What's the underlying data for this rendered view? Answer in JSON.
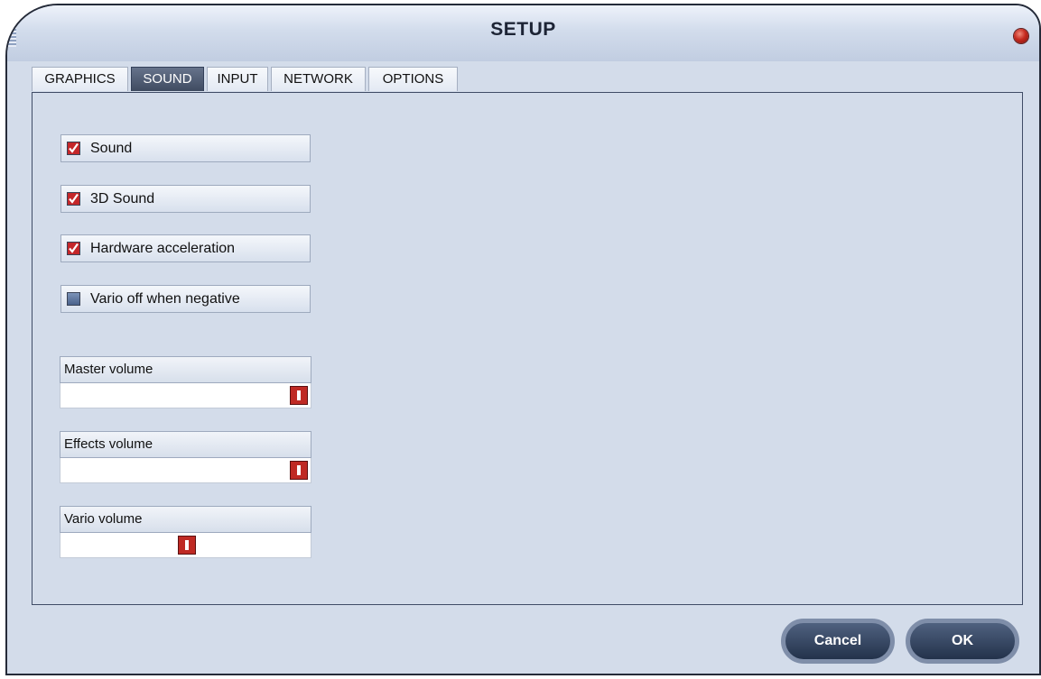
{
  "window": {
    "title": "SETUP"
  },
  "tabs": [
    {
      "label": "GRAPHICS",
      "active": false
    },
    {
      "label": "SOUND",
      "active": true
    },
    {
      "label": "INPUT",
      "active": false
    },
    {
      "label": "NETWORK",
      "active": false
    },
    {
      "label": "OPTIONS",
      "active": false
    }
  ],
  "checkboxes": [
    {
      "label": "Sound",
      "checked": true
    },
    {
      "label": "3D Sound",
      "checked": true
    },
    {
      "label": "Hardware acceleration",
      "checked": true
    },
    {
      "label": "Vario off when negative",
      "checked": false
    }
  ],
  "volumes": [
    {
      "label": "Master volume",
      "level": 1.0
    },
    {
      "label": "Effects volume",
      "level": 1.0
    },
    {
      "label": "Vario volume",
      "level": 0.5
    }
  ],
  "buttons": {
    "cancel": "Cancel",
    "ok": "OK"
  },
  "colors": {
    "background": "#d3dcea",
    "active_tab": "#4a566d",
    "checked": "#c4272a",
    "unchecked": "#4a628b",
    "slider_thumb": "#bf2a24",
    "button": "#2c3d5a"
  },
  "icons": {
    "close": "close-icon",
    "check": "checkmark-icon"
  }
}
